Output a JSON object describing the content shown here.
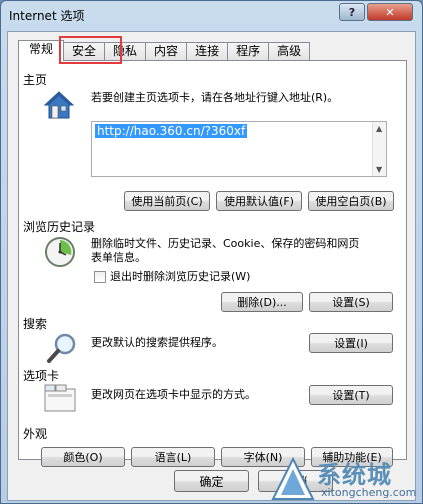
{
  "window": {
    "title": "Internet 选项",
    "help_label": "?",
    "close_label": "✕"
  },
  "tabs": [
    {
      "label": "常规",
      "active": true
    },
    {
      "label": "安全",
      "highlighted": true
    },
    {
      "label": "隐私"
    },
    {
      "label": "内容"
    },
    {
      "label": "连接"
    },
    {
      "label": "程序"
    },
    {
      "label": "高级"
    }
  ],
  "homepage": {
    "label": "主页",
    "description": "若要创建主页选项卡，请在各地址行键入地址(R)。",
    "url_value": "http://hao.360.cn/?360xf",
    "buttons": {
      "use_current": "使用当前页(C)",
      "use_default": "使用默认值(F)",
      "use_blank": "使用空白页(B)"
    }
  },
  "history": {
    "label": "浏览历史记录",
    "description_line1": "删除临时文件、历史记录、Cookie、保存的密码和网页",
    "description_line2": "表单信息。",
    "checkbox_label": "退出时删除浏览历史记录(W)",
    "checkbox_checked": false,
    "buttons": {
      "delete": "删除(D)...",
      "settings": "设置(S)"
    }
  },
  "search": {
    "label": "搜索",
    "description": "更改默认的搜索提供程序。",
    "settings_label": "设置(I)"
  },
  "tabs_section": {
    "label": "选项卡",
    "description": "更改网页在选项卡中显示的方式。",
    "settings_label": "设置(T)"
  },
  "appearance": {
    "label": "外观",
    "buttons": {
      "colors": "颜色(O)",
      "languages": "语言(L)",
      "fonts": "字体(N)",
      "accessibility": "辅助功能(E)"
    }
  },
  "footer": {
    "ok": "确定",
    "cancel": "取消"
  },
  "watermark": {
    "text": "系统城",
    "url": "xitongcheng.com"
  },
  "colors": {
    "selection": "#3399ff",
    "highlight_box": "#e23b3b",
    "watermark": "#5a8fb8"
  },
  "icons": [
    "house-icon",
    "clock-history-icon",
    "magnifier-icon",
    "tabs-icon"
  ]
}
